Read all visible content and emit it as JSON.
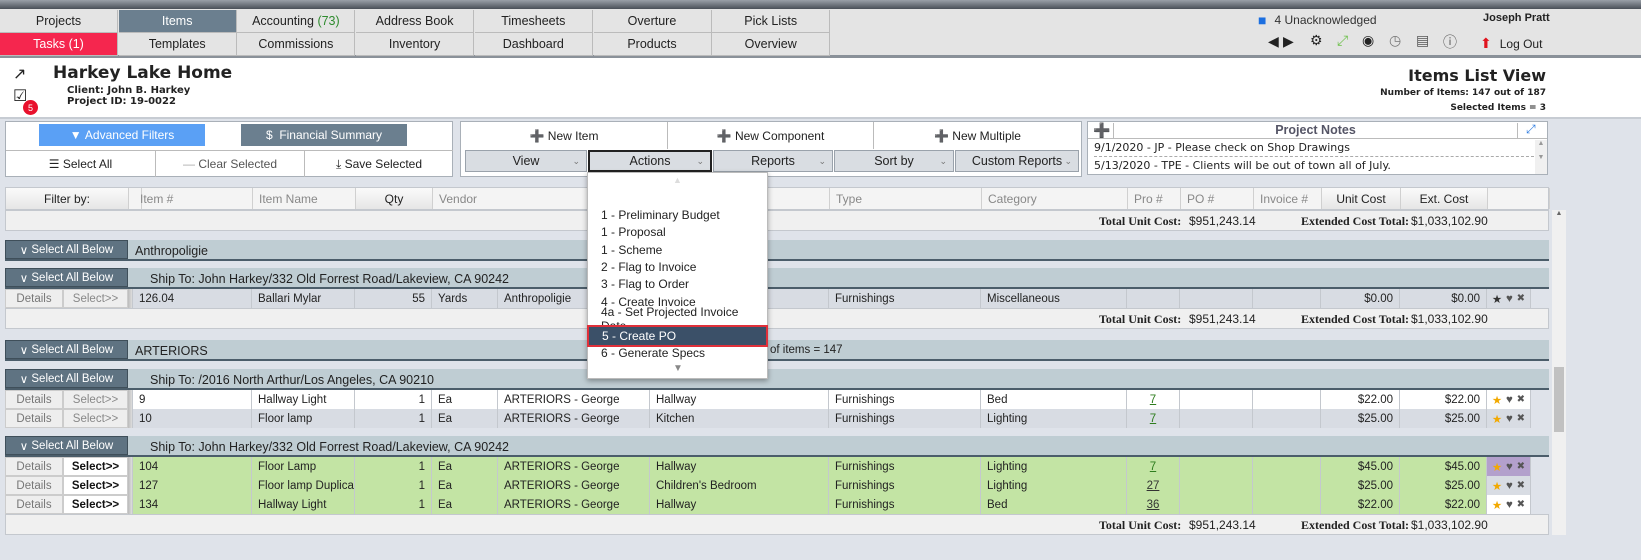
{
  "nav": {
    "row1": [
      {
        "label": "Projects"
      },
      {
        "label": "Items",
        "active": true
      },
      {
        "label": "Accounting",
        "count": "(73)"
      },
      {
        "label": "Address Book"
      },
      {
        "label": "Timesheets"
      },
      {
        "label": "Overture"
      },
      {
        "label": "Pick Lists"
      }
    ],
    "row2": [
      {
        "label": "Tasks (1)"
      },
      {
        "label": "Templates"
      },
      {
        "label": "Commissions"
      },
      {
        "label": "Inventory"
      },
      {
        "label": "Dashboard"
      },
      {
        "label": "Products"
      },
      {
        "label": "Overview"
      }
    ]
  },
  "user": {
    "notifications": "4 Unacknowledged",
    "name": "Joseph Pratt",
    "logout": "Log Out"
  },
  "project": {
    "title": "Harkey Lake Home",
    "client": "Client: John B. Harkey",
    "project_id": "Project ID: 19-0022",
    "task_badge": "5"
  },
  "view": {
    "title": "Items List View",
    "count": "Number of Items: 147 out of 187",
    "selected": "Selected Items = 3"
  },
  "filters": {
    "advanced": "Advanced Filters",
    "financial": "Financial Summary",
    "select_all": "Select All",
    "clear": "Clear Selected",
    "save": "Save Selected"
  },
  "toolbar": {
    "new_item": "New Item",
    "new_component": "New Component",
    "new_multiple": "New Multiple",
    "view": "View",
    "actions": "Actions",
    "reports": "Reports",
    "sort_by": "Sort by",
    "custom_reports": "Custom Reports"
  },
  "notes": {
    "title": "Project Notes",
    "items": [
      "9/1/2020 - JP - Please check on Shop Drawings",
      "5/13/2020 - TPE - Clients will be out of town all of July."
    ]
  },
  "actions_menu": {
    "items": [
      "1 - Preliminary Budget",
      "1 - Proposal",
      "1 - Scheme",
      "2 - Flag to Invoice",
      "3 - Flag to Order",
      "4 - Create Invoice",
      "4a - Set Projected Invoice Date",
      "5 - Create PO",
      "6 - Generate Specs"
    ],
    "highlighted": "5 - Create PO"
  },
  "table": {
    "headers": {
      "filter": "Filter by:",
      "item": "Item #",
      "name": "Item Name",
      "qty": "Qty",
      "vendor": "Vendor",
      "type": "Type",
      "category": "Category",
      "pro": "Pro #",
      "po": "PO #",
      "invoice": "Invoice #",
      "unit_cost": "Unit Cost",
      "ext_cost": "Ext. Cost"
    },
    "totals": {
      "unit_label": "Total Unit Cost:",
      "unit_value": "$951,243.14",
      "ext_label": "Extended Cost Total:",
      "ext_value": "$1,033,102.90"
    },
    "select_all_below": "Select All Below",
    "details": "Details",
    "select": "Select>>",
    "count_text": "of items = 147",
    "groups": [
      {
        "vendor": "Anthropoligie",
        "ship_to": "Ship To: John Harkey/332 Old Forrest Road/Lakeview, CA 90242",
        "rows": [
          {
            "item": "126.04",
            "name": "Ballari Mylar",
            "qty": "55",
            "unit": "Yards",
            "vendor": "Anthropoligie",
            "location": "",
            "type": "Furnishings",
            "category": "Miscellaneous",
            "pro": "",
            "unit_cost": "$0.00",
            "ext_cost": "$0.00"
          }
        ]
      },
      {
        "vendor": "ARTERIORS",
        "ships": [
          {
            "ship_to": "Ship To: /2016 North Arthur/Los Angeles, CA 90210",
            "rows": [
              {
                "item": "9",
                "name": "Hallway Light",
                "qty": "1",
                "unit": "Ea",
                "vendor": "ARTERIORS - George",
                "location": "Hallway",
                "type": "Furnishings",
                "category": "Bed",
                "pro": "7",
                "unit_cost": "$22.00",
                "ext_cost": "$22.00"
              },
              {
                "item": "10",
                "name": "Floor lamp",
                "qty": "1",
                "unit": "Ea",
                "vendor": "ARTERIORS - George",
                "location": "Kitchen",
                "type": "Furnishings",
                "category": "Lighting",
                "pro": "7",
                "unit_cost": "$25.00",
                "ext_cost": "$25.00"
              }
            ]
          },
          {
            "ship_to": "Ship To: John Harkey/332 Old Forrest Road/Lakeview, CA 90242",
            "rows": [
              {
                "item": "104",
                "name": "Floor Lamp",
                "qty": "1",
                "unit": "Ea",
                "vendor": "ARTERIORS - George",
                "location": "Hallway",
                "type": "Furnishings",
                "category": "Lighting",
                "pro": "7",
                "unit_cost": "$45.00",
                "ext_cost": "$45.00"
              },
              {
                "item": "127",
                "name": "Floor lamp Duplicated",
                "qty": "1",
                "unit": "Ea",
                "vendor": "ARTERIORS - George",
                "location": "Children's Bedroom",
                "type": "Furnishings",
                "category": "Lighting",
                "pro": "27",
                "unit_cost": "$25.00",
                "ext_cost": "$25.00"
              },
              {
                "item": "134",
                "name": "Hallway Light",
                "qty": "1",
                "unit": "Ea",
                "vendor": "ARTERIORS - George",
                "location": "Hallway",
                "type": "Furnishings",
                "category": "Bed",
                "pro": "36",
                "unit_cost": "$22.00",
                "ext_cost": "$22.00"
              }
            ]
          }
        ]
      }
    ]
  },
  "colors": {
    "tasks": "#f5264e",
    "active_nav": "#6b7f8f",
    "advanced_filters": "#5aa0f5",
    "selected_row": "#c3e4a4",
    "star": "#f2a900",
    "menu_highlight": "#3b5068"
  }
}
